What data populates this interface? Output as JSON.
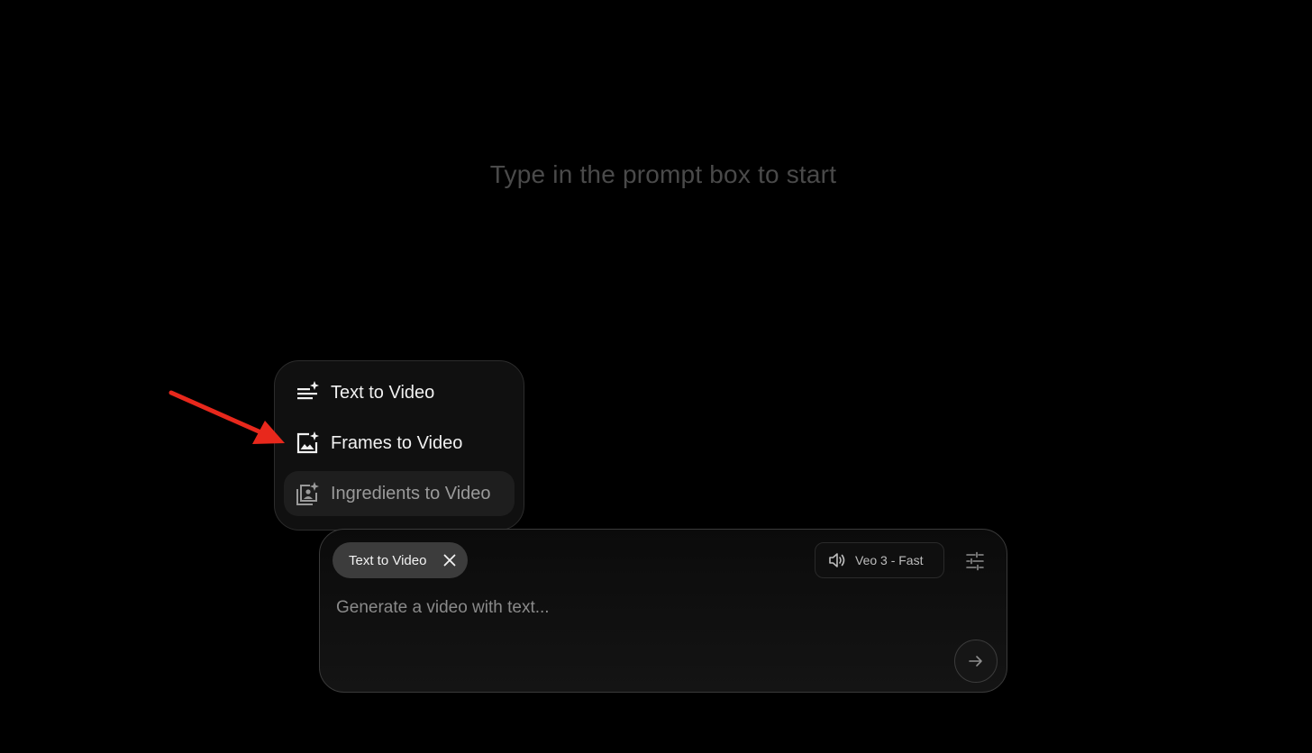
{
  "hint": {
    "text": "Type in the prompt box to start"
  },
  "mode_menu": {
    "items": [
      {
        "label": "Text to Video",
        "icon": "text-sparkle-icon"
      },
      {
        "label": "Frames to Video",
        "icon": "image-sparkle-icon"
      },
      {
        "label": "Ingredients to Video",
        "icon": "stacked-images-sparkle-icon"
      }
    ]
  },
  "prompt_box": {
    "chip_label": "Text to Video",
    "model_label": "Veo 3 - Fast",
    "input_value": "",
    "input_placeholder": "Generate a video with text..."
  },
  "colors": {
    "background": "#000000",
    "annotation_arrow": "#e8281c"
  }
}
